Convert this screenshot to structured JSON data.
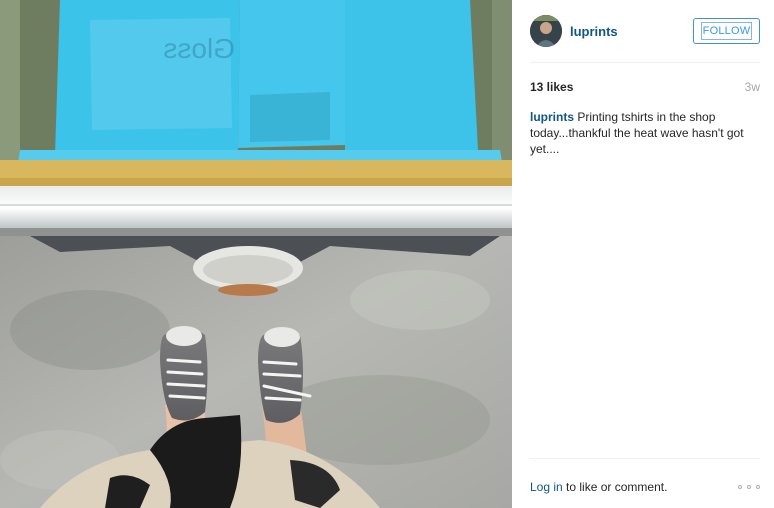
{
  "post": {
    "image_alt": "Printing tshirts in the shop",
    "screen_text": "Gloss",
    "user": {
      "username": "luprints",
      "avatar_icon": "user-avatar"
    },
    "follow_label": "FOLLOW",
    "likes": "13 likes",
    "age": "3w",
    "caption": {
      "username": "luprints",
      "text": " Printing tshirts in the shop today...thankful the heat wave hasn't got yet...."
    },
    "footer": {
      "login_label": "Log in",
      "login_suffix": " to like or comment.",
      "more_icon": "more-options-icon"
    }
  },
  "colors": {
    "link": "#125688",
    "follow": "#3897f0",
    "divider": "#efefef",
    "muted": "#a5a7aa"
  }
}
